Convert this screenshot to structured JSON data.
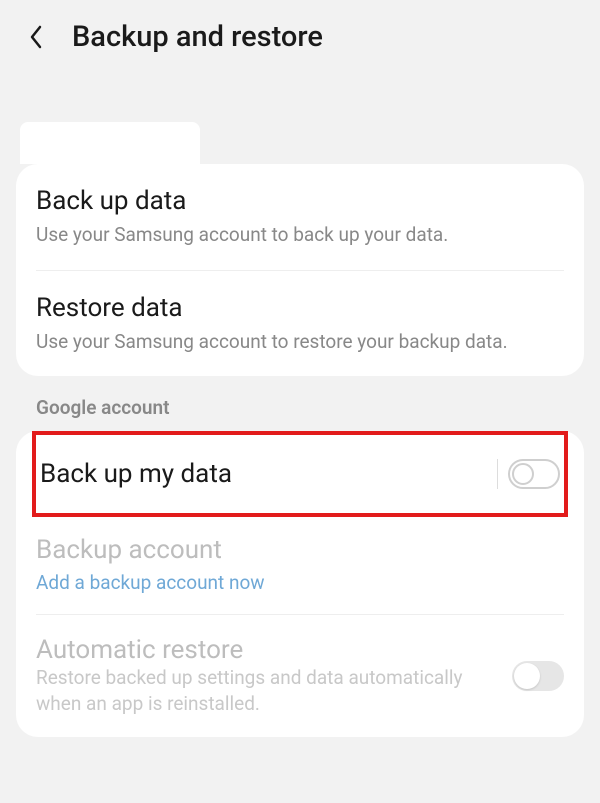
{
  "header": {
    "title": "Backup and restore"
  },
  "samsung": {
    "backup": {
      "title": "Back up data",
      "subtitle": "Use your Samsung account to back up your data."
    },
    "restore": {
      "title": "Restore data",
      "subtitle": "Use your Samsung account to restore your backup data."
    }
  },
  "google": {
    "section_header": "Google account",
    "backup_my_data": {
      "title": "Back up my data",
      "state": "off"
    },
    "backup_account": {
      "title": "Backup account",
      "link": "Add a backup account now"
    },
    "auto_restore": {
      "title": "Automatic restore",
      "subtitle": "Restore backed up settings and data automatically when an app is reinstalled.",
      "state": "off"
    }
  }
}
